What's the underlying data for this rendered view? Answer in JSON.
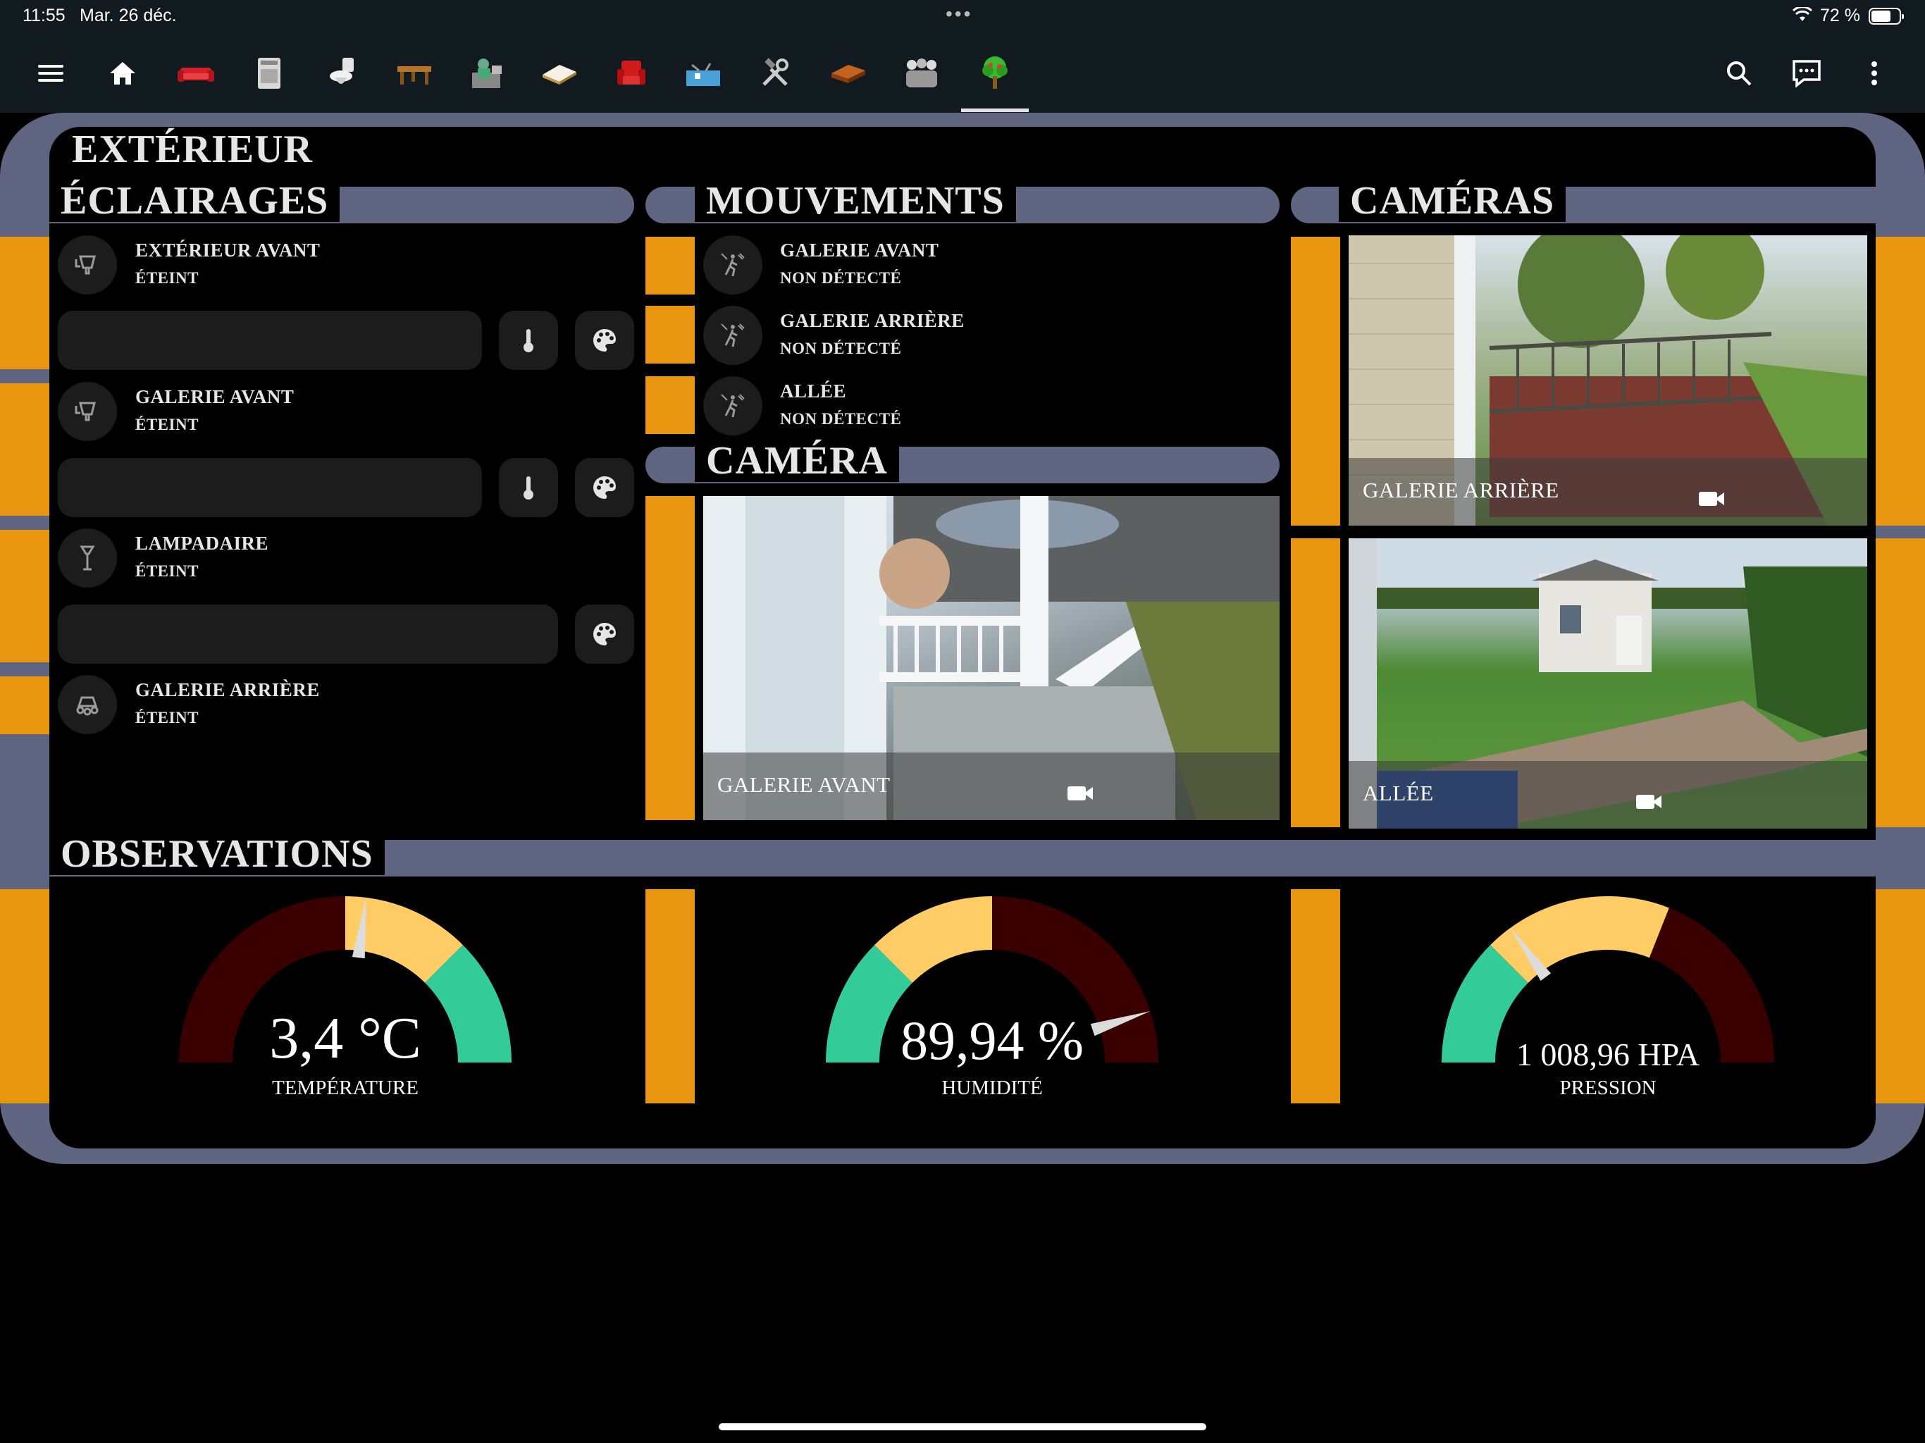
{
  "status_bar": {
    "time": "11:55",
    "date": "Mar. 26 déc.",
    "battery": "72 %",
    "battery_level": 0.72
  },
  "toolbar": {
    "tabs": [
      "home-icon",
      "sofa-icon",
      "stove-icon",
      "toilet-icon",
      "table-icon",
      "office-icon",
      "bed-icon",
      "armchair-icon",
      "basement-icon",
      "tools-icon",
      "attic-icon",
      "family-icon",
      "tree-icon"
    ],
    "active_tab": "tree-icon"
  },
  "page": {
    "title": "EXTÉRIEUR"
  },
  "lighting": {
    "title": "ÉCLAIRAGES",
    "items": [
      {
        "name": "EXTÉRIEUR AVANT",
        "state": "ÉTEINT"
      },
      {
        "name": "GALERIE AVANT",
        "state": "ÉTEINT"
      },
      {
        "name": "LAMPADAIRE",
        "state": "ÉTEINT"
      },
      {
        "name": "GALERIE ARRIÈRE",
        "state": "ÉTEINT"
      }
    ]
  },
  "motion": {
    "title": "MOUVEMENTS",
    "items": [
      {
        "name": "GALERIE AVANT",
        "state": "NON DÉTECTÉ"
      },
      {
        "name": "GALERIE ARRIÈRE",
        "state": "NON DÉTECTÉ"
      },
      {
        "name": "ALLÉE",
        "state": "NON DÉTECTÉ"
      }
    ]
  },
  "camera": {
    "title": "CAMÉRA",
    "feed": "GALERIE AVANT"
  },
  "cameras": {
    "title": "CAMÉRAS",
    "feeds": [
      "GALERIE ARRIÈRE",
      "ALLÉE"
    ]
  },
  "observations": {
    "title": "OBSERVATIONS",
    "gauges": [
      {
        "value": "3,4 °C",
        "label": "TEMPÉRATURE",
        "needle_fraction": 0.54
      },
      {
        "value": "89,94 %",
        "label": "HUMIDITÉ",
        "needle_fraction": 0.9
      },
      {
        "value": "1 008,96 HPA",
        "label": "PRESSION",
        "needle_fraction": 0.3
      }
    ]
  },
  "colors": {
    "accent_orange": "#e8960f",
    "frame_slate": "#5f6480",
    "gauge_dark_red": "#3a0000",
    "gauge_yellow": "#ffcc66",
    "gauge_green": "#33cc99"
  }
}
